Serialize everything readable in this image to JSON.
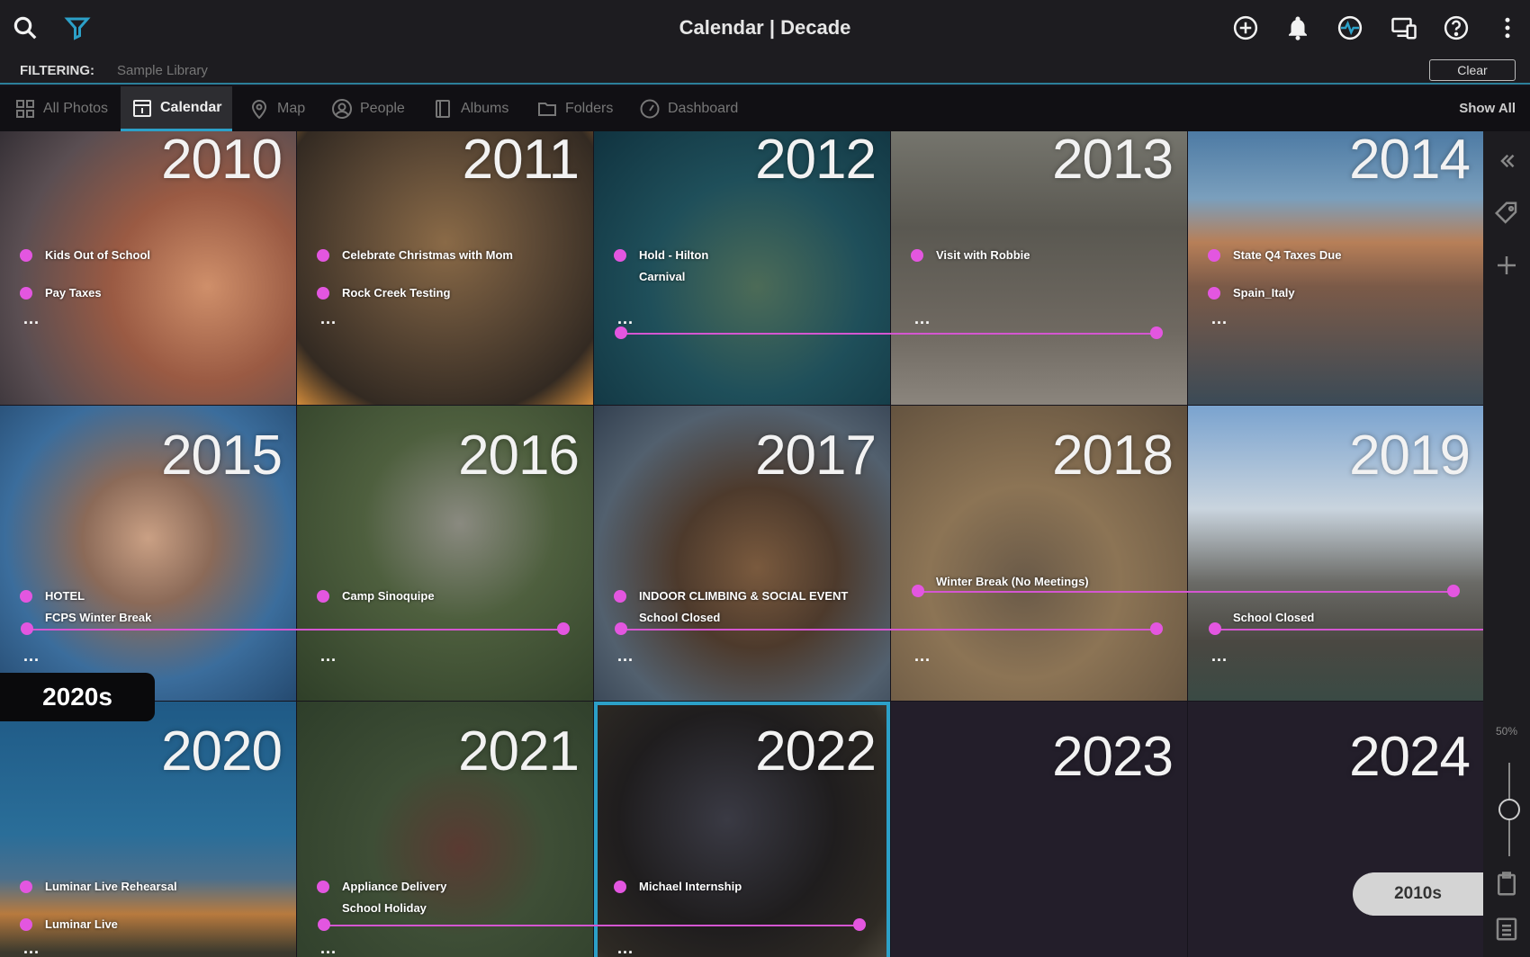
{
  "app": {
    "title": "Calendar | Decade"
  },
  "filter": {
    "label": "FILTERING:",
    "value": "Sample Library",
    "clear_label": "Clear"
  },
  "nav": {
    "tabs": [
      {
        "label": "All Photos"
      },
      {
        "label": "Calendar"
      },
      {
        "label": "Map"
      },
      {
        "label": "People"
      },
      {
        "label": "Albums"
      },
      {
        "label": "Folders"
      },
      {
        "label": "Dashboard"
      }
    ],
    "active": "Calendar",
    "show_all_label": "Show All"
  },
  "years": [
    {
      "year": "2010",
      "events": [
        "Kids Out of School",
        "Pay Taxes"
      ]
    },
    {
      "year": "2011",
      "events": [
        "Celebrate Christmas with Mom",
        "Rock Creek Testing"
      ]
    },
    {
      "year": "2012",
      "events": [
        "Hold - Hilton",
        "Carnival"
      ]
    },
    {
      "year": "2013",
      "events": [
        "Visit with Robbie"
      ]
    },
    {
      "year": "2014",
      "events": [
        "State Q4 Taxes Due",
        "Spain_Italy"
      ]
    },
    {
      "year": "2015",
      "events": [
        "HOTEL",
        "FCPS Winter Break"
      ]
    },
    {
      "year": "2016",
      "events": [
        "Camp Sinoquipe"
      ]
    },
    {
      "year": "2017",
      "events": [
        "INDOOR CLIMBING & SOCIAL EVENT",
        "School Closed"
      ]
    },
    {
      "year": "2018",
      "events": [
        "Winter Break (No Meetings)"
      ]
    },
    {
      "year": "2019",
      "events": [
        "School Closed"
      ]
    },
    {
      "year": "2020",
      "events": [
        "Luminar Live Rehearsal",
        "Luminar Live"
      ]
    },
    {
      "year": "2021",
      "events": [
        "Appliance Delivery",
        "School Holiday"
      ]
    },
    {
      "year": "2022",
      "events": [
        "Michael Internship"
      ]
    },
    {
      "year": "2023",
      "events": []
    },
    {
      "year": "2024",
      "events": []
    }
  ],
  "more_label": "...",
  "current_decade_label": "2020s",
  "decade_pill_label": "2010s",
  "zoom_label": "50%",
  "colors": {
    "accent": "#2ca0c8",
    "event_dot": "#e356e0",
    "background": "#16141c"
  }
}
